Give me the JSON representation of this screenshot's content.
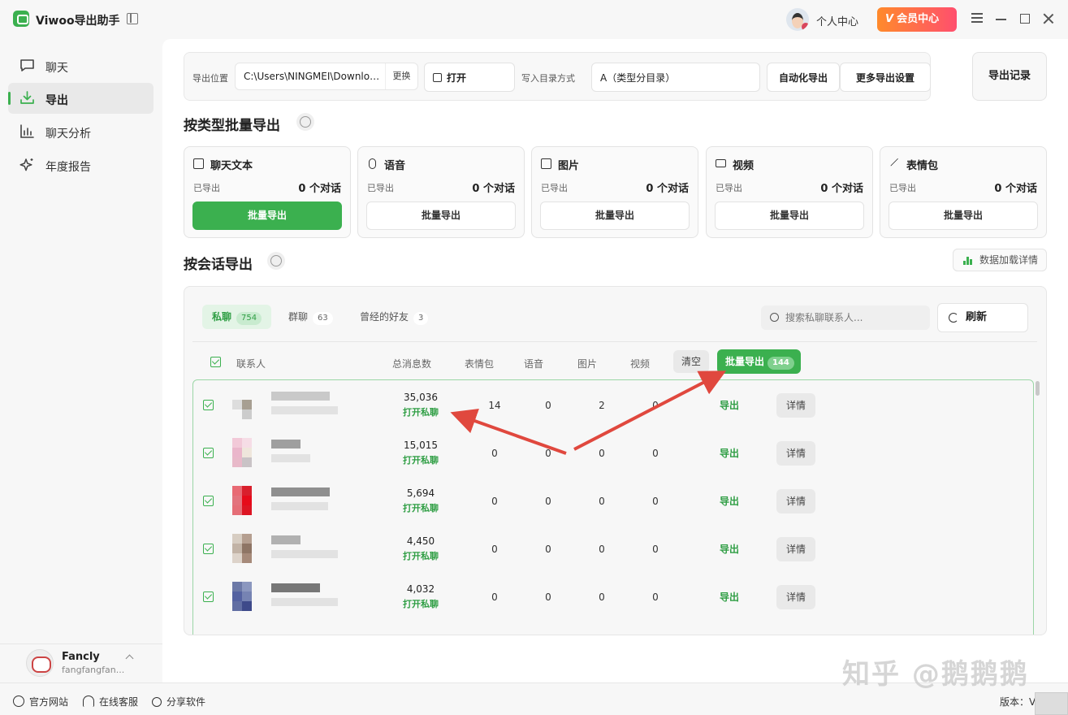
{
  "app": {
    "title": "Viwoo导出助手"
  },
  "topbar": {
    "profile": "个人中心",
    "vip_badge": "V",
    "vip": "会员中心"
  },
  "nav": {
    "items": [
      {
        "label": "聊天",
        "icon": "chat-icon"
      },
      {
        "label": "导出",
        "icon": "download-icon",
        "active": true
      },
      {
        "label": "聊天分析",
        "icon": "bar-chart-icon"
      },
      {
        "label": "年度报告",
        "icon": "sparkle-icon"
      }
    ]
  },
  "user": {
    "name": "Fancly",
    "id": "fangfangfan..."
  },
  "footer": {
    "site": "官方网站",
    "support": "在线客服",
    "share": "分享软件",
    "version": "版本：V"
  },
  "toolbar": {
    "location_label": "导出位置",
    "path": "C:\\Users\\NINGMEI\\Downloads",
    "change": "更换",
    "open": "打开",
    "dir_mode_label": "写入目录方式",
    "dir_mode_value": "A（类型分目录）",
    "auto_export": "自动化导出",
    "more_settings": "更多导出设置",
    "records": "导出记录"
  },
  "by_type": {
    "title": "按类型批量导出",
    "exported_label": "已导出",
    "cards": [
      {
        "title": "聊天文本",
        "count": "0 个对话",
        "button": "批量导出",
        "icon": "message-icon"
      },
      {
        "title": "语音",
        "count": "0 个对话",
        "button": "批量导出",
        "icon": "mic-icon"
      },
      {
        "title": "图片",
        "count": "0 个对话",
        "button": "批量导出",
        "icon": "image-icon"
      },
      {
        "title": "视频",
        "count": "0 个对话",
        "button": "批量导出",
        "icon": "video-icon"
      },
      {
        "title": "表情包",
        "count": "0 个对话",
        "button": "批量导出",
        "icon": "magic-wand-icon"
      }
    ]
  },
  "by_session": {
    "title": "按会话导出",
    "load_details": "数据加载详情",
    "tabs": [
      {
        "label": "私聊",
        "count": "754"
      },
      {
        "label": "群聊",
        "count": "63"
      },
      {
        "label": "曾经的好友",
        "count": "3"
      }
    ],
    "search_placeholder": "搜索私聊联系人...",
    "refresh": "刷新",
    "headers": {
      "contact": "联系人",
      "total": "总消息数",
      "stickers": "表情包",
      "voice": "语音",
      "images": "图片",
      "video": "视频"
    },
    "clear": "清空",
    "bulk_export": "批量导出",
    "bulk_count": "144",
    "row_open": "打开私聊",
    "row_export": "导出",
    "row_detail": "详情",
    "rows": [
      {
        "total": "35,036",
        "stickers": "14",
        "voice": "0",
        "images": "2",
        "video": "0"
      },
      {
        "total": "15,015",
        "stickers": "0",
        "voice": "0",
        "images": "0",
        "video": "0"
      },
      {
        "total": "5,694",
        "stickers": "0",
        "voice": "0",
        "images": "0",
        "video": "0"
      },
      {
        "total": "4,450",
        "stickers": "0",
        "voice": "0",
        "images": "0",
        "video": "0"
      },
      {
        "total": "4,032",
        "stickers": "0",
        "voice": "0",
        "images": "0",
        "video": "0"
      }
    ]
  },
  "watermark": "知乎 @鹅鹅鹅",
  "colors": {
    "accent": "#3bb04f",
    "annotation_arrow": "#e0483e",
    "vip_gradient_start": "#ff8a2b",
    "vip_gradient_end": "#ff4f6e"
  }
}
